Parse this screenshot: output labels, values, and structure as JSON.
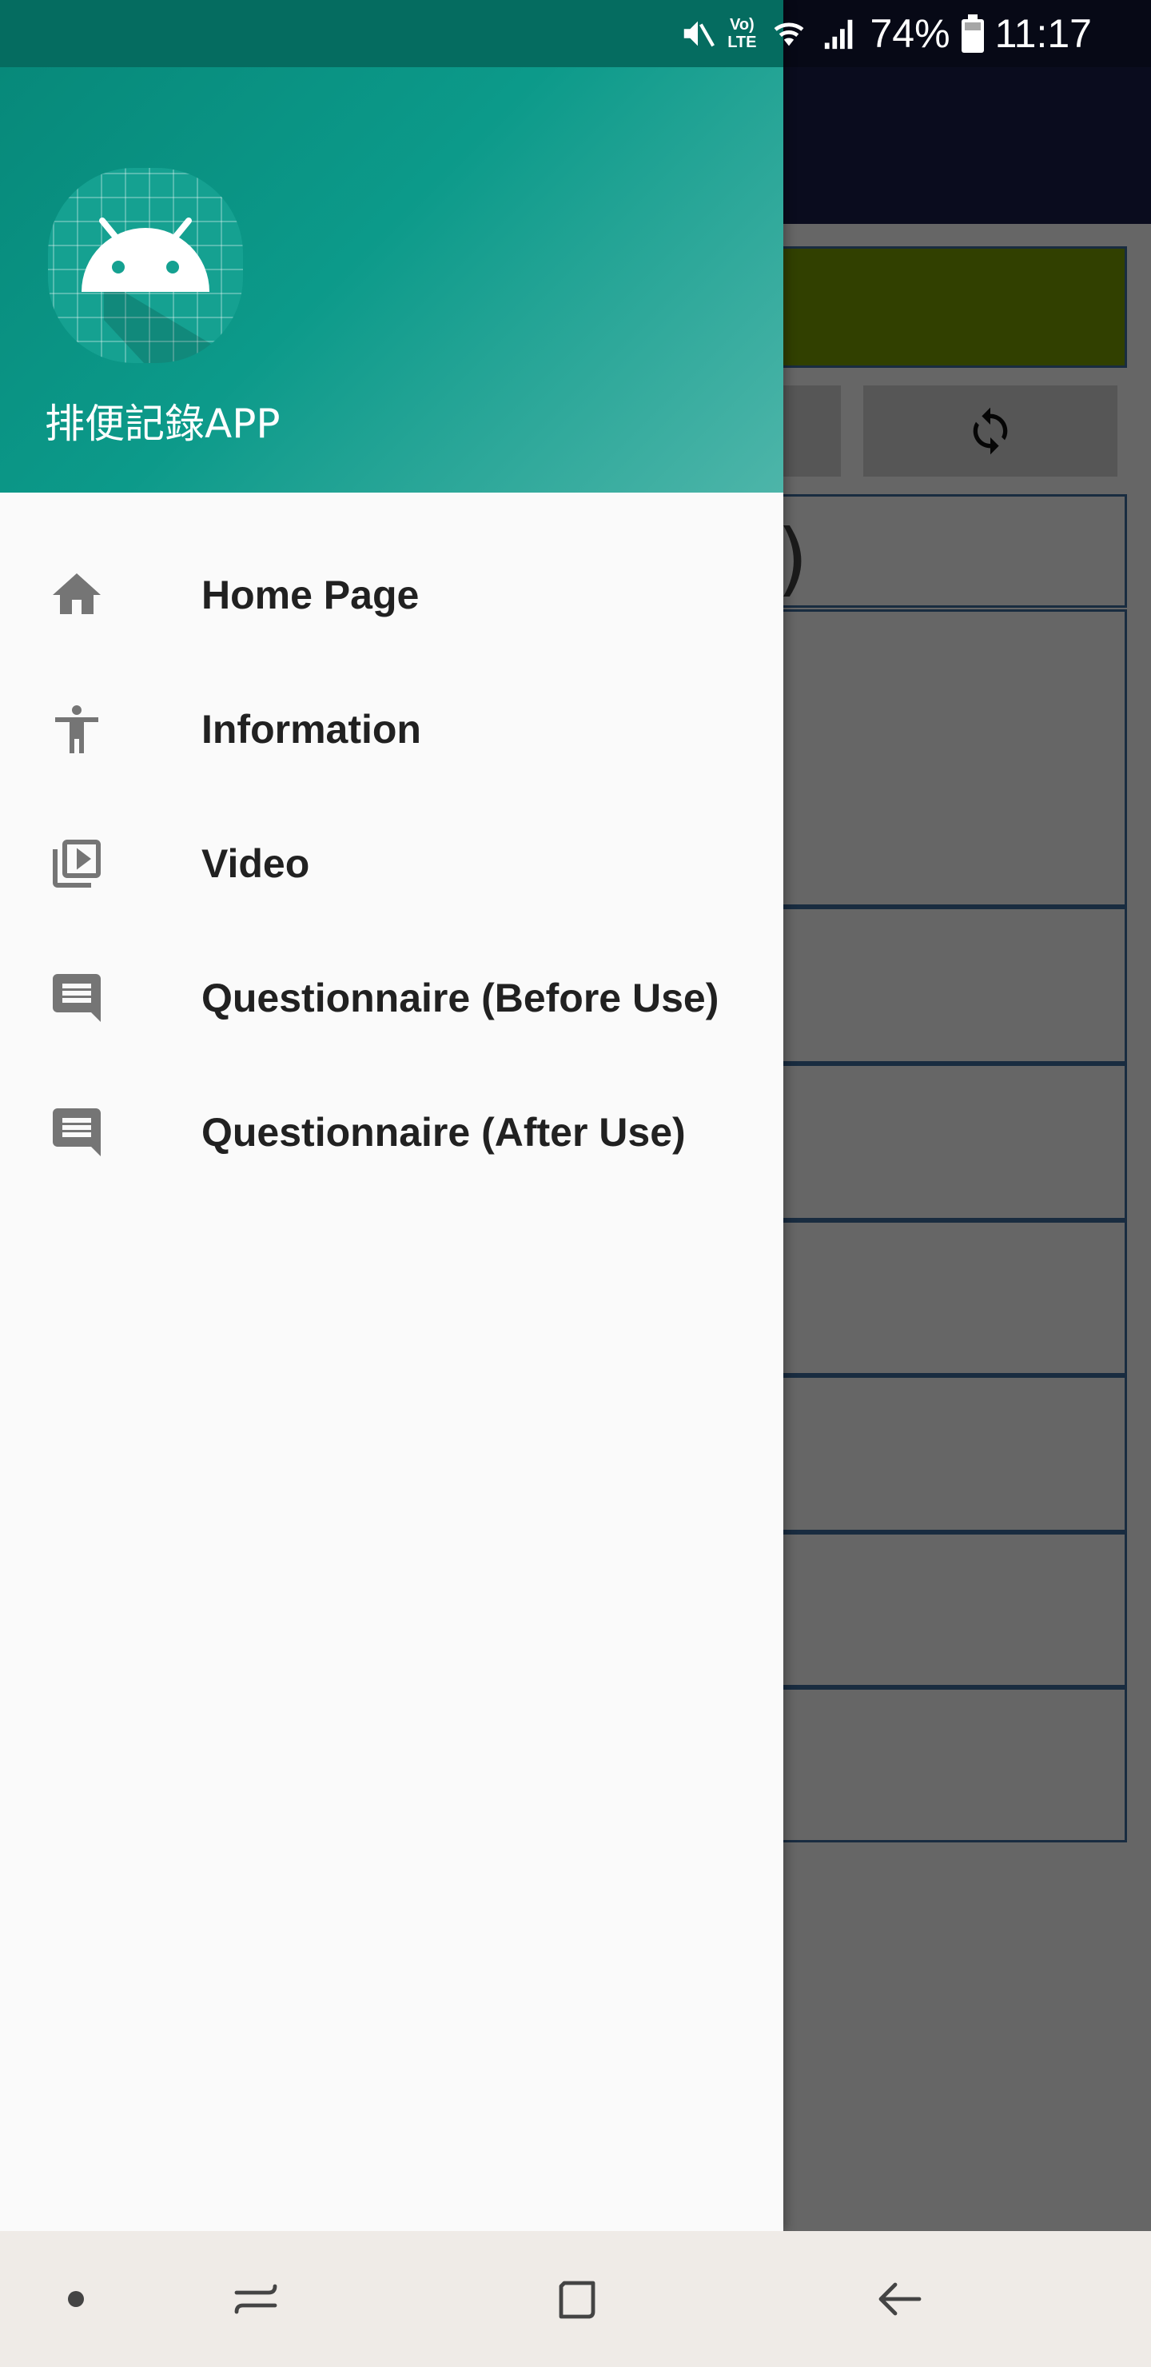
{
  "status_bar": {
    "battery": "74%",
    "time": "11:17",
    "volte_top": "Vo)",
    "volte_bottom": "LTE"
  },
  "drawer": {
    "app_name": "排便記錄APP",
    "items": [
      {
        "label": "Home Page",
        "icon": "home-icon"
      },
      {
        "label": "Information",
        "icon": "accessibility-icon"
      },
      {
        "label": "Video",
        "icon": "video-library-icon"
      },
      {
        "label": "Questionnaire (Before Use)",
        "icon": "message-icon"
      },
      {
        "label": "Questionnaire (After Use)",
        "icon": "message-icon"
      }
    ]
  },
  "background": {
    "paren": ")"
  },
  "colors": {
    "drawer_header_start": "#07897a",
    "drawer_header_end": "#4db5a9",
    "toolbar": "#1a1f4c",
    "accent_green": "#7aa000"
  }
}
